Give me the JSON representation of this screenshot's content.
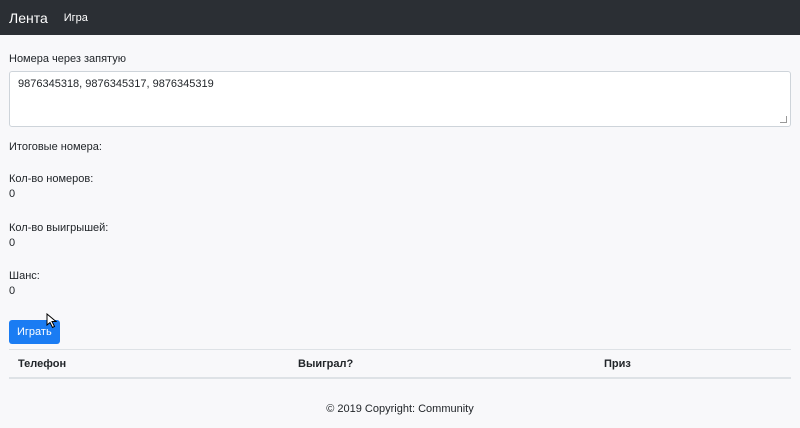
{
  "navbar": {
    "brand": "Лента",
    "link_game": "Игра"
  },
  "form": {
    "numbers_label": "Номера через запятую",
    "numbers_value": "9876345318, 9876345317, 9876345319"
  },
  "results": {
    "result_label": "Итоговые номера:",
    "count_label": "Кол-во номеров:",
    "count_value": "0",
    "wins_label": "Кол-во выигрышей:",
    "wins_value": "0",
    "chance_label": "Шанс:",
    "chance_value": "0"
  },
  "play_button": "Играть",
  "table": {
    "columns": [
      "Телефон",
      "Выиграл?",
      "Приз"
    ]
  },
  "footer": "© 2019 Copyright: Community",
  "colors": {
    "navbar": "#2b2f34",
    "primary": "#1a7cf3"
  }
}
